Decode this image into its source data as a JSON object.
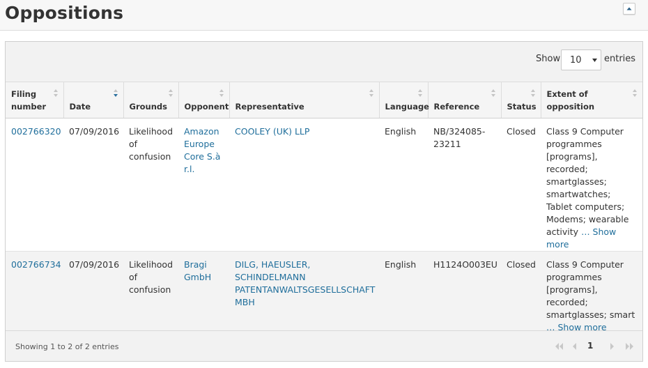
{
  "header": {
    "title": "Oppositions"
  },
  "toolbar": {
    "show_label": "Show",
    "entries_value": "10",
    "entries_label": "entries"
  },
  "columns": {
    "filing_number": "Filing number",
    "date": "Date",
    "grounds": "Grounds",
    "opponent": "Opponent",
    "representative": "Representative",
    "language": "Language",
    "reference": "Reference",
    "status": "Status",
    "extent": "Extent of opposition"
  },
  "rows": [
    {
      "filing_number": "002766320",
      "date": "07/09/2016",
      "grounds": "Likelihood of confusion",
      "opponent": "Amazon Europe Core S.à r.l.",
      "representative": "COOLEY (UK) LLP",
      "language": "English",
      "reference": "NB/324085-23211",
      "status": "Closed",
      "extent": "Class 9 Computer programmes [programs], recorded; smartglasses; smartwatches; Tablet computers; Modems; wearable activity",
      "show_more": "… Show more"
    },
    {
      "filing_number": "002766734",
      "date": "07/09/2016",
      "grounds": "Likelihood of confusion",
      "opponent": "Bragi GmbH",
      "representative": "DILG, HAEUSLER, SCHINDELMANN PATENTANWALTSGESELLSCHAFT MBH",
      "language": "English",
      "reference": "H1124O003EU",
      "status": "Closed",
      "extent": "Class 9 Computer programmes [programs], recorded; smartglasses; smart",
      "show_more": "… Show more"
    }
  ],
  "footer": {
    "info": "Showing 1 to 2 of 2 entries",
    "current_page": "1"
  },
  "colors": {
    "link": "#1f6e9b",
    "header_bg": "#f7f7f7",
    "row_alt": "#f3f3f3"
  },
  "icons": [
    "collapse-up-icon",
    "sort-icon",
    "sort-desc-icon",
    "first-page-icon",
    "prev-page-icon",
    "next-page-icon",
    "last-page-icon"
  ]
}
